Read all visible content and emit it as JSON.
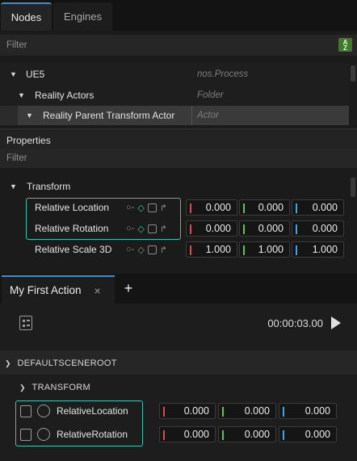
{
  "tabs": {
    "nodes": "Nodes",
    "engines": "Engines"
  },
  "node_filter": {
    "placeholder": "Filter"
  },
  "sort_icon": "sort-alpha-icon",
  "tree": [
    {
      "label": "UE5",
      "type": "nos.Process"
    },
    {
      "label": "Reality Actors",
      "type": "Folder"
    },
    {
      "label": "Reality Parent Transform Actor",
      "type": "Actor"
    }
  ],
  "properties": {
    "title": "Properties",
    "filter_placeholder": "Filter",
    "group": "Transform",
    "rows": [
      {
        "label": "Relative Location",
        "x": "0.000",
        "y": "0.000",
        "z": "0.000"
      },
      {
        "label": "Relative Rotation",
        "x": "0.000",
        "y": "0.000",
        "z": "0.000"
      },
      {
        "label": "Relative Scale 3D",
        "x": "1.000",
        "y": "1.000",
        "z": "1.000"
      }
    ]
  },
  "action": {
    "tab_label": "My First Action",
    "close": "×",
    "add": "+",
    "time": "00:00:03.00",
    "root": "DEFAULTSCENEROOT",
    "group": "TRANSFORM",
    "rows": [
      {
        "label": "RelativeLocation",
        "x": "0.000",
        "y": "0.000",
        "z": "0.000"
      },
      {
        "label": "RelativeRotation",
        "x": "0.000",
        "y": "0.000",
        "z": "0.000"
      }
    ]
  },
  "colors": {
    "x": "#e0474c",
    "y": "#5cc25a",
    "z": "#3ea4ea",
    "highlight": "#3fbfae",
    "accent": "#3a8ec9"
  }
}
